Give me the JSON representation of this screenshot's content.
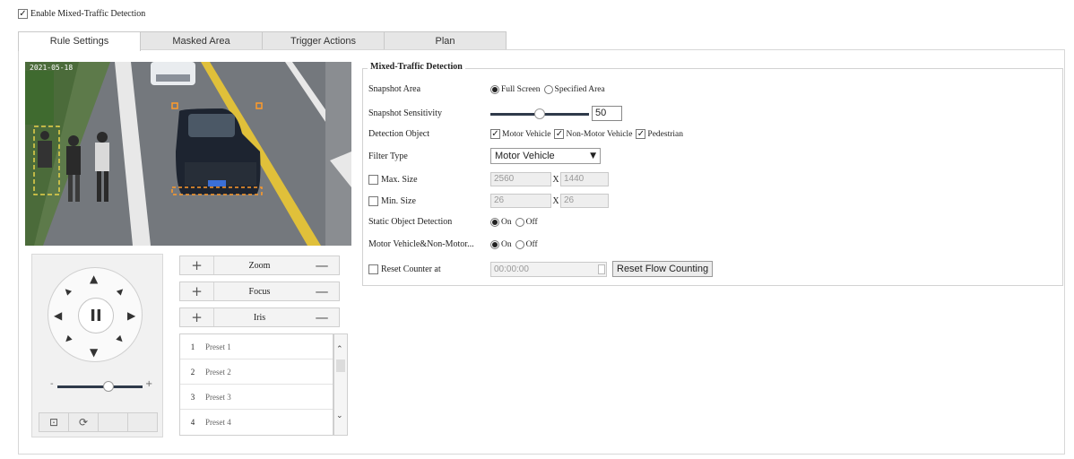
{
  "enable": {
    "label": "Enable Mixed-Traffic Detection",
    "checked": true
  },
  "tabs": [
    {
      "label": "Rule Settings",
      "active": true
    },
    {
      "label": "Masked Area",
      "active": false
    },
    {
      "label": "Trigger Actions",
      "active": false
    },
    {
      "label": "Plan",
      "active": false
    }
  ],
  "video": {
    "overlay_text": "2021-05-18"
  },
  "ptz": {
    "pause_glyph": "II",
    "speed_minus": "-",
    "speed_plus": "+",
    "bottom_icons": [
      "camera-lock-icon",
      "refresh-icon",
      "",
      ""
    ],
    "speed_level": 0.6
  },
  "lens": [
    {
      "label": "Zoom",
      "plus": "+",
      "minus": "—"
    },
    {
      "label": "Focus",
      "plus": "+",
      "minus": "—"
    },
    {
      "label": "Iris",
      "plus": "+",
      "minus": "—"
    }
  ],
  "presets": [
    {
      "num": "1",
      "label": "Preset 1"
    },
    {
      "num": "2",
      "label": "Preset 2"
    },
    {
      "num": "3",
      "label": "Preset 3"
    },
    {
      "num": "4",
      "label": "Preset 4"
    }
  ],
  "detection": {
    "legend": "Mixed-Traffic Detection",
    "snapshot_area": {
      "label": "Snapshot Area",
      "opt1": "Full Screen",
      "opt2": "Specified Area",
      "selected": "Full Screen"
    },
    "sensitivity": {
      "label": "Snapshot Sensitivity",
      "value": "50",
      "fraction": 0.5
    },
    "detection_object": {
      "label": "Detection Object",
      "o1": "Motor Vehicle",
      "o2": "Non-Motor Vehicle",
      "o3": "Pedestrian"
    },
    "filter_type": {
      "label": "Filter Type",
      "value": "Motor Vehicle"
    },
    "max_size": {
      "label": "Max. Size",
      "w": "2560",
      "sep": "X",
      "h": "1440"
    },
    "min_size": {
      "label": "Min. Size",
      "w": "26",
      "sep": "X",
      "h": "26"
    },
    "static_object": {
      "label": "Static Object Detection",
      "on": "On",
      "off": "Off",
      "selected": "On"
    },
    "motor_nonmotor": {
      "label": "Motor Vehicle&Non-Motor...",
      "on": "On",
      "off": "Off",
      "selected": "On"
    },
    "reset_counter": {
      "label": "Reset Counter at",
      "time": "00:00:00",
      "button": "Reset Flow Counting"
    }
  },
  "colors": {
    "accent_track": "#2f3a4a",
    "tab_bg": "#e6e6e6",
    "border": "#d2d2d2"
  }
}
